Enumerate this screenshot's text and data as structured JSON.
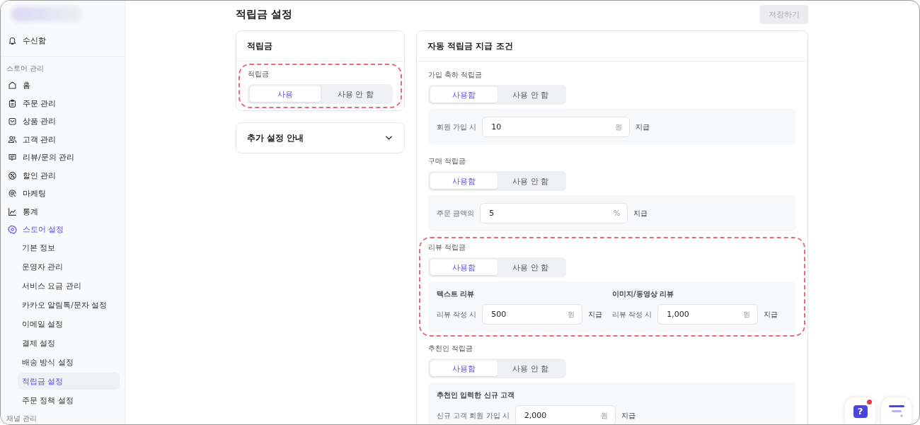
{
  "sidebar": {
    "inbox": {
      "label": "수신함"
    },
    "sections": [
      {
        "title": "스토어 관리",
        "items": [
          {
            "label": "홈",
            "selected": false
          },
          {
            "label": "주문 관리",
            "selected": false
          },
          {
            "label": "상품 관리",
            "selected": false
          },
          {
            "label": "고객 관리",
            "selected": false
          },
          {
            "label": "리뷰/문의 관리",
            "selected": false
          },
          {
            "label": "할인 관리",
            "selected": false
          },
          {
            "label": "마케팅",
            "selected": false
          },
          {
            "label": "통계",
            "selected": false
          },
          {
            "label": "스토어 설정",
            "selected": true,
            "children": [
              {
                "label": "기본 정보",
                "selected": false
              },
              {
                "label": "운영자 관리",
                "selected": false
              },
              {
                "label": "서비스 요금 관리",
                "selected": false
              },
              {
                "label": "카카오 알림톡/문자 설정",
                "selected": false
              },
              {
                "label": "이메일 설정",
                "selected": false
              },
              {
                "label": "결제 설정",
                "selected": false
              },
              {
                "label": "배송 방식 설정",
                "selected": false
              },
              {
                "label": "적립금 설정",
                "selected": true
              },
              {
                "label": "주문 정책 설정",
                "selected": false
              }
            ]
          }
        ]
      },
      {
        "title": "채널 관리"
      }
    ]
  },
  "page": {
    "title": "적립금 설정",
    "save_button": {
      "label": "저장하기",
      "disabled": true
    }
  },
  "points_card": {
    "title": "적립금",
    "highlighted": true,
    "field_label": "적립금",
    "options": [
      {
        "label": "사용",
        "selected": true
      },
      {
        "label": "사용 안 함",
        "selected": false
      }
    ]
  },
  "guide_card": {
    "title": "추가 설정 안내",
    "expanded": false
  },
  "auto_card": {
    "title": "자동 적립금 지급 조건",
    "sections": [
      {
        "title": "가입 축하 적립금",
        "highlighted": false,
        "options": [
          {
            "label": "사용함",
            "selected": true
          },
          {
            "label": "사용 안 함",
            "selected": false
          }
        ],
        "groups": [
          {
            "label": "회원 가입 시",
            "value": "10",
            "unit": "원",
            "suffix": "지급"
          }
        ]
      },
      {
        "title": "구매 적립금",
        "highlighted": false,
        "options": [
          {
            "label": "사용함",
            "selected": true
          },
          {
            "label": "사용 안 함",
            "selected": false
          }
        ],
        "groups": [
          {
            "label": "주문 금액의",
            "value": "5",
            "unit": "%",
            "suffix": "지급"
          }
        ]
      },
      {
        "title": "리뷰 적립금",
        "highlighted": true,
        "options": [
          {
            "label": "사용함",
            "selected": true
          },
          {
            "label": "사용 안 함",
            "selected": false
          }
        ],
        "groups": [
          {
            "subtitle": "텍스트 리뷰",
            "label": "리뷰 작성 시",
            "value": "500",
            "unit": "원",
            "suffix": "지급"
          },
          {
            "subtitle": "이미지/동영상 리뷰",
            "label": "리뷰 작성 시",
            "value": "1,000",
            "unit": "원",
            "suffix": "지급"
          }
        ]
      },
      {
        "title": "추천인 적립금",
        "highlighted": false,
        "options": [
          {
            "label": "사용함",
            "selected": true
          },
          {
            "label": "사용 안 함",
            "selected": false
          }
        ],
        "groups": [
          {
            "subtitle": "추천인 입력한 신규 고객",
            "label": "신규 고객 회원 가입 시",
            "value": "2,000",
            "unit": "원",
            "suffix": "지급"
          }
        ]
      }
    ]
  },
  "floating": {
    "help": {
      "glyph": "?",
      "badge": true
    }
  }
}
